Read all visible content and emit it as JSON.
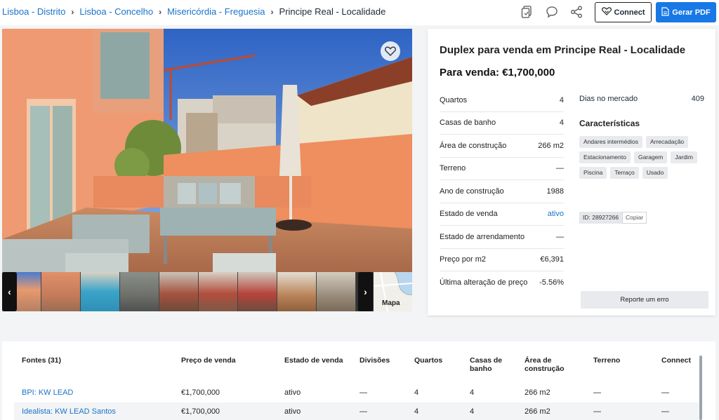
{
  "breadcrumbs": [
    {
      "label": "Lisboa - Distrito"
    },
    {
      "label": "Lisboa - Concelho"
    },
    {
      "label": "Misericórdia - Freguesia"
    },
    {
      "label": "Principe Real - Localidade"
    }
  ],
  "toolbar": {
    "icons": [
      "copy-doc-icon",
      "chat-icon",
      "share-icon"
    ],
    "connect_label": "Connect",
    "pdf_label": "Gerar PDF"
  },
  "gallery": {
    "map_label": "Mapa",
    "thumbnail_count": 9
  },
  "listing": {
    "title": "Duplex para venda em Principe Real - Localidade",
    "price": "Para venda: €1,700,000",
    "facts": [
      {
        "label": "Quartos",
        "value": "4"
      },
      {
        "label": "Casas de banho",
        "value": "4"
      },
      {
        "label": "Área de construção",
        "value": "266 m2"
      },
      {
        "label": "Terreno",
        "value": "—"
      },
      {
        "label": "Ano de construção",
        "value": "1988"
      },
      {
        "label": "Estado de venda",
        "value": "ativo"
      },
      {
        "label": "Estado de arrendamento",
        "value": "—"
      },
      {
        "label": "Preço por m2",
        "value": "€6,391"
      },
      {
        "label": "Última alteração de preço",
        "value": "-5.56%"
      }
    ],
    "days_label": "Dias no mercado",
    "days_value": "409",
    "features_title": "Características",
    "features": [
      "Andares intermédios",
      "Arrecadação",
      "Estacionamento",
      "Garagem",
      "Jardim",
      "Piscina",
      "Terraço",
      "Usado"
    ],
    "id_text": "ID: 28927266",
    "copy_label": "Copiar",
    "report_label": "Reporte um erro"
  },
  "sources": {
    "headers": [
      "Fontes (31)",
      "Preço de venda",
      "Estado de venda",
      "Divisões",
      "Quartos",
      "Casas de banho",
      "Área de construção",
      "Terreno",
      "Connect"
    ],
    "rows": [
      [
        "BPI: KW LEAD",
        "€1,700,000",
        "ativo",
        "—",
        "4",
        "4",
        "266 m2",
        "—",
        "—"
      ],
      [
        "Idealista: KW LEAD Santos",
        "€1,700,000",
        "ativo",
        "—",
        "4",
        "4",
        "266 m2",
        "—",
        "—"
      ]
    ]
  }
}
